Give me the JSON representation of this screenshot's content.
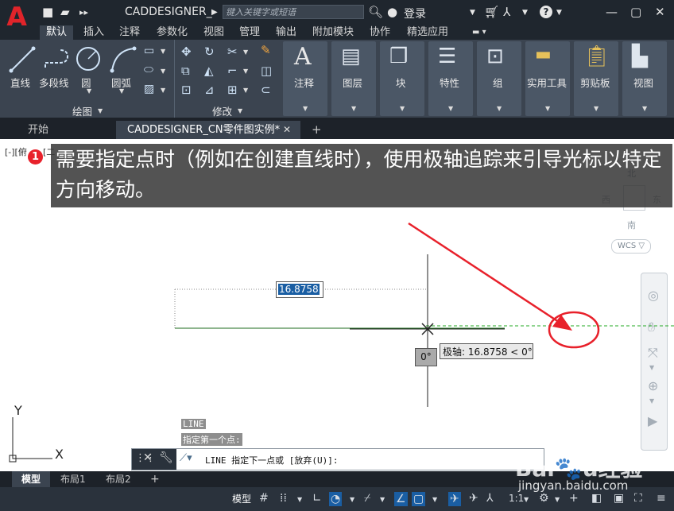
{
  "app": {
    "title": "CADDESIGNER_",
    "search_placeholder": "键入关键字或短语",
    "login_label": "登录"
  },
  "ribbon_tabs": [
    "默认",
    "插入",
    "注释",
    "参数化",
    "视图",
    "管理",
    "输出",
    "附加模块",
    "协作",
    "精选应用"
  ],
  "draw_panel": {
    "title": "绘图",
    "tools": [
      "直线",
      "多段线",
      "圆",
      "圆弧"
    ]
  },
  "modify_panel": {
    "title": "修改"
  },
  "big_panels": [
    "注释",
    "图层",
    "块",
    "特性",
    "组",
    "实用工具",
    "剪贴板",
    "视图"
  ],
  "doc_tabs": {
    "start": "开始",
    "active": "CADDESIGNER_CN零件图实例*",
    "add": "+"
  },
  "viewport": {
    "label": "[-][俯",
    "label_tail": "[二",
    "compass": {
      "north": "北",
      "south": "南",
      "east": "东",
      "west": "西"
    },
    "wcs": "WCS ▽"
  },
  "banner": {
    "step": "1",
    "text": "需要指定点时（例如在创建直线时），使用极轴追踪来引导光标以特定方向移动。"
  },
  "drawing": {
    "dim_input": "16.8758",
    "angle_input": "0°",
    "tooltip": "极轴: 16.8758 < 0°",
    "ucs": {
      "y": "Y",
      "x": "X"
    }
  },
  "command": {
    "history_1": "LINE",
    "history_2": "指定第一个点:",
    "prompt": "LINE 指定下一点或 [放弃(U)]:"
  },
  "layout_tabs": [
    "模型",
    "布局1",
    "布局2",
    "+"
  ],
  "status": {
    "model": "模型",
    "scale": "1:1"
  },
  "watermark": "jingyan.baidu.com",
  "colors": {
    "accent": "#1a5ea3",
    "brand_red": "#e0242a",
    "polar_track": "#22aa22",
    "annotation_red": "#e8212b"
  }
}
